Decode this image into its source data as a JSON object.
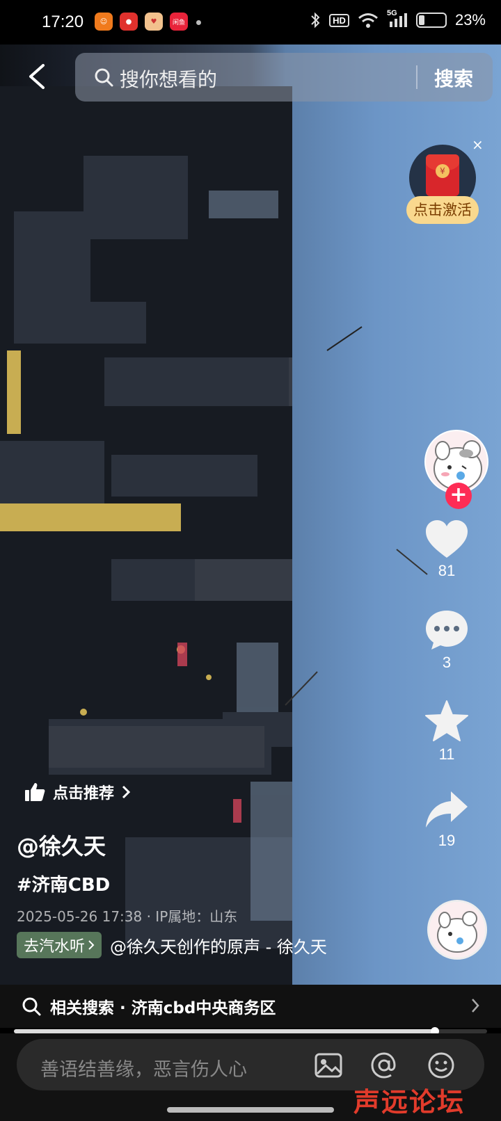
{
  "status_bar": {
    "time": "17:20",
    "apps": [
      {
        "icon": "orange-app-icon",
        "color": "#f07a1d",
        "glyph": "☺"
      },
      {
        "icon": "red-app-icon",
        "color": "#e0312d",
        "glyph": "●"
      },
      {
        "icon": "pig-app-icon",
        "color": "#f2c18d",
        "glyph": "♥"
      },
      {
        "icon": "red-label-app-icon",
        "color": "#e8233a",
        "glyph": "闲鱼"
      }
    ],
    "hd_label": "HD",
    "network_label": "5G",
    "battery_percent": "23%",
    "battery_level": 0.23
  },
  "top_bar": {
    "search_placeholder": "搜你想看的",
    "search_button": "搜索"
  },
  "red_packet": {
    "label": "点击激活",
    "close_glyph": "×"
  },
  "actions": {
    "like_count": "81",
    "comment_count": "3",
    "favorite_count": "11",
    "share_count": "19",
    "follow_glyph": "+"
  },
  "video_info": {
    "recommend_label": "点击推荐",
    "author": "@徐久天",
    "hashtag": "#济南CBD",
    "meta": "2025-05-26 17:38 · IP属地：山东",
    "music_chip": "去汽水听",
    "music_text": "@徐久天创作的原声 - 徐久天"
  },
  "related_search": {
    "text": "相关搜索 · 济南cbd中央商务区"
  },
  "progress": {
    "fraction": 0.89
  },
  "comment_bar": {
    "placeholder": "善语结善缘，恶言伤人心"
  },
  "watermark": "声远论坛",
  "colors": {
    "accent_red": "#fe2c55",
    "sky": "#7aa4d3",
    "red_packet_label_bg": "#f9d88e"
  }
}
